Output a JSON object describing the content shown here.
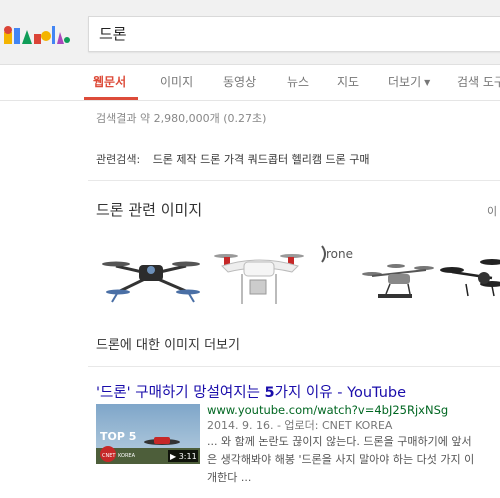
{
  "search": {
    "query": "드론"
  },
  "tabs": [
    {
      "label": "웹문서",
      "active": true
    },
    {
      "label": "이미지"
    },
    {
      "label": "동영상"
    },
    {
      "label": "뉴스"
    },
    {
      "label": "지도"
    },
    {
      "label": "더보기"
    },
    {
      "label": "검색 도구"
    }
  ],
  "stats": "검색결과 약 2,980,000개 (0.27초)",
  "related": {
    "label": "관련검색:",
    "items": [
      "드론 제작",
      "드론 가격",
      "쿼드콥터",
      "헬리캠",
      "드론 구매"
    ]
  },
  "images": {
    "heading": "드론 관련 이미지",
    "right_label": "이",
    "drone_logo_text": "rone",
    "more_link": "드론에 대한 이미지 더보기"
  },
  "result": {
    "title_quote": "'드론' 구매하기 망설여지는 ",
    "title_num": "5",
    "title_rest": "가지 이유 - ",
    "title_site": "YouTube",
    "url": "www.youtube.com/watch?v=4bJ25RjxNSg",
    "meta": "2014. 9. 16. - 업로더: CNET KOREA",
    "snippet": [
      "... 와 함께 논란도 끊이지 않는다. 드론을 구매하기에 앞서",
      "은 생각해봐야 해봉 '드론을 사지 말아야 하는 다섯 가지 이",
      "개한다 ..."
    ],
    "thumb": {
      "top_text": "TOP 5",
      "brand": "CNET",
      "brand_sub": "KOREA",
      "duration": "▶ 3:11"
    }
  },
  "colors": {
    "accent": "#dd4b39",
    "link": "#1a0dab",
    "url": "#006621"
  }
}
